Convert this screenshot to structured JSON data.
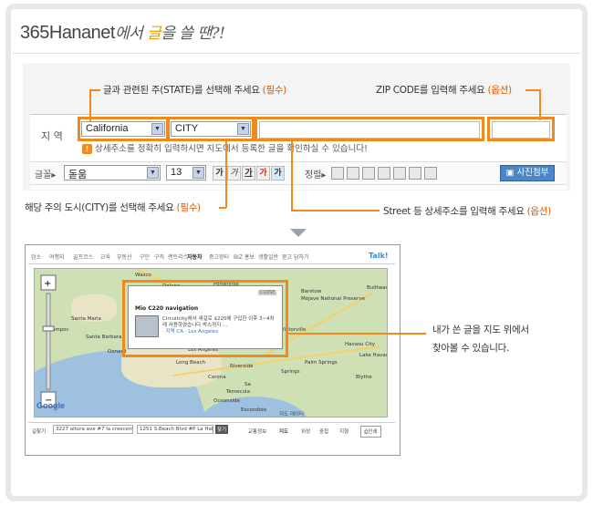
{
  "header": {
    "brand": "365Hananet",
    "suffix_pre": "에서 ",
    "suffix_hl": "글",
    "suffix_post": "을 쓸 땐?!"
  },
  "form": {
    "region_label": "지 역",
    "state_value": "California",
    "city_value": "CITY",
    "warning": "상세주소를 정확히 입력하시면 지도에서 등록한 글을 확인하실 수 있습니다!",
    "toolbar": {
      "font_label": "글꼴",
      "font_value": "돋움",
      "size_label": "",
      "size_value": "13",
      "format_buttons": [
        "가",
        "가",
        "가",
        "가",
        "가"
      ],
      "align_label": "정렬",
      "photo_button": "사진첨부"
    }
  },
  "notes": {
    "state": "글과 관련된 주(STATE)를 선택해 주세요",
    "state_req": "(필수)",
    "zip": "ZIP CODE를 입력해 주세요",
    "zip_req": "(옵션)",
    "city": "해당 주의 도시(CITY)를 선택해 주세요",
    "city_req": "(필수)",
    "street": "Street 등 상세주소를 입력해 주세요",
    "street_req": "(옵션)"
  },
  "map_shot": {
    "tabs": [
      "업소",
      "여행지",
      "골프코스",
      "교육",
      "부동산",
      "구인",
      "구직",
      "렌트리스",
      "자동차",
      "중고장터",
      "BIZ 홍보",
      "생활일반",
      "묻고 답하기"
    ],
    "talk": "Talk!",
    "places": [
      "Wasco",
      "Delano",
      "Porterville",
      "Bakersfield",
      "Santa Maria",
      "Lompoc",
      "Santa Barbara",
      "Oxnard",
      "Los Angeles",
      "Long Beach",
      "Riverside",
      "Oceanside",
      "Escondido",
      "Barstow",
      "Mojave National Preserve",
      "Victorville",
      "Palm Springs",
      "Bullhead City",
      "Lake Havasu City",
      "Havasu City",
      "Blythe",
      "Corona",
      "Temecula",
      "Springs",
      "Sa"
    ],
    "popup_title": "Mio C220 navigation",
    "popup_text": "Circuitcity에서 새걸로 $220에 구입한 이후 3~4차례 사용하였습니다.박스까지 ...",
    "popup_location": "· 지역 CA · Los Angeles",
    "popup_close": "CLOSE",
    "google": "Google",
    "bottom_label": "길찾기",
    "addr_from": "3227 altura ave #7 la crescenta, C",
    "addr_to": "1251 S.Beach Blvd #P La Habra, C",
    "go": "찾기",
    "map_data": "지도 데이터",
    "modes": [
      "교통정보",
      "지도",
      "위성",
      "중첩",
      "지형"
    ],
    "print": "인쇄"
  },
  "side_note": {
    "line1": "내가 쓴 글을 지도 위에서",
    "line2": "찾아볼 수 있습니다."
  },
  "colors": {
    "highlight": "#f08a1c",
    "required": "#e05a00",
    "photo_button": "#4a86c8"
  }
}
